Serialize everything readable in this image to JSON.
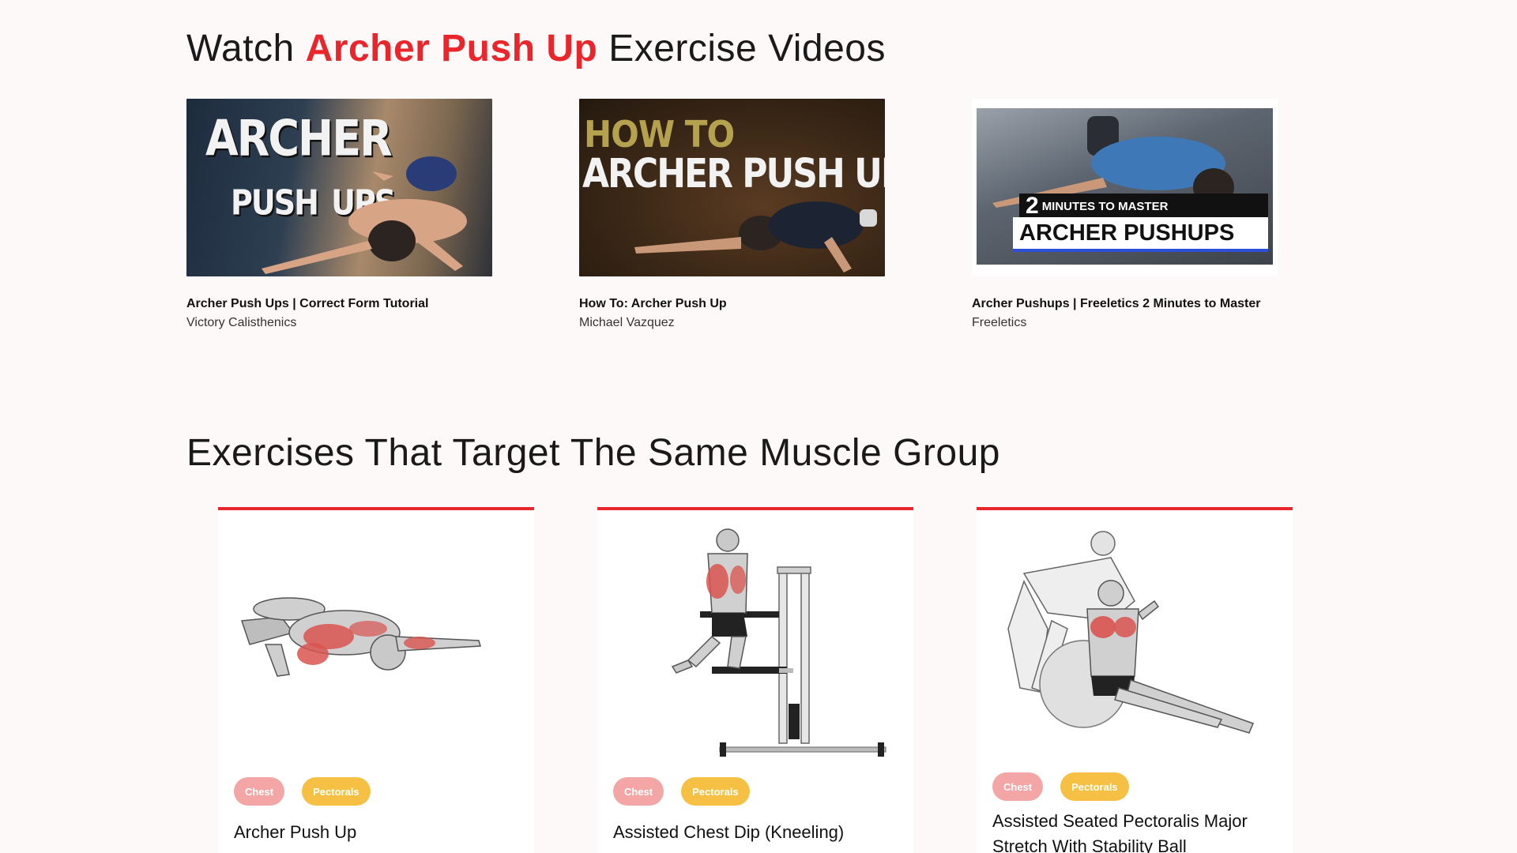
{
  "videos_section": {
    "heading_prefix": "Watch",
    "heading_accent": "Archer Push Up",
    "heading_suffix": "Exercise Videos",
    "videos": [
      {
        "title": "Archer Push Ups | Correct Form Tutorial",
        "channel": "Victory Calisthenics",
        "thumb_text_1": "ARCHER",
        "thumb_text_2": "PUSH",
        "thumb_text_3": "UPS"
      },
      {
        "title": "How To: Archer Push Up",
        "channel": "Michael Vazquez",
        "thumb_text_1": "HOW TO",
        "thumb_text_2": "ARCHER PUSH UP"
      },
      {
        "title": "Archer Pushups | Freeletics 2 Minutes to Master",
        "channel": "Freeletics",
        "thumb_text_num": "2",
        "thumb_text_1": "MINUTES TO MASTER",
        "thumb_text_2": "ARCHER PUSHUPS"
      }
    ]
  },
  "same_muscle_section": {
    "heading": "Exercises That Target The Same Muscle Group",
    "cards": [
      {
        "title": "Archer Push Up",
        "tags": [
          "Chest",
          "Pectorals"
        ]
      },
      {
        "title": "Assisted Chest Dip (Kneeling)",
        "tags": [
          "Chest",
          "Pectorals"
        ]
      },
      {
        "title": "Assisted Seated Pectoralis Major Stretch With Stability Ball",
        "tags": [
          "Chest",
          "Pectorals"
        ]
      }
    ]
  },
  "colors": {
    "accent": "#e8262b",
    "tag_chest": "#f4a6a6",
    "tag_pectorals": "#f5c043",
    "muscle_highlight": "#d9534f"
  }
}
